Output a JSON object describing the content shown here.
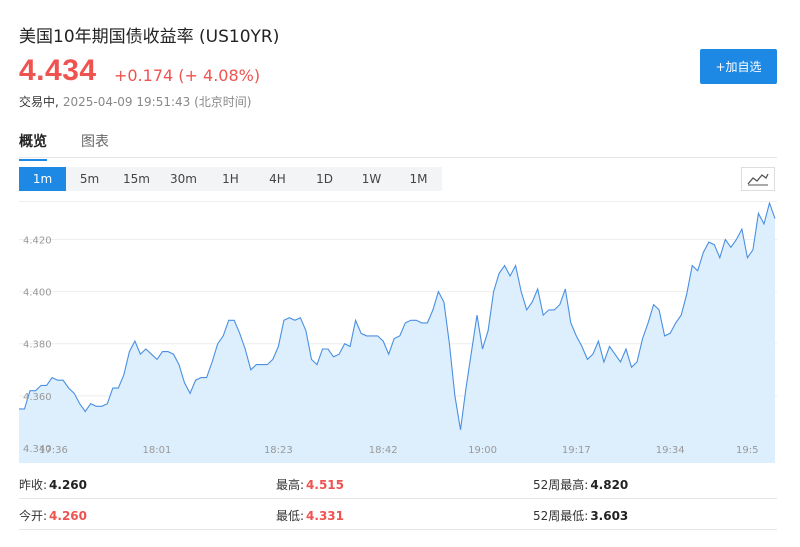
{
  "header": {
    "title": "美国10年期国债收益率 (US10YR)",
    "price": "4.434",
    "change": "+0.174 (+ 4.08%)",
    "status_label": "交易中,",
    "timestamp": "2025-04-09 19:51:43 (北京时间)",
    "add_button": "+加自选"
  },
  "tabs": [
    {
      "label": "概览",
      "active": true
    },
    {
      "label": "图表",
      "active": false
    }
  ],
  "intervals": [
    {
      "label": "1m",
      "active": true
    },
    {
      "label": "5m"
    },
    {
      "label": "15m"
    },
    {
      "label": "30m"
    },
    {
      "label": "1H"
    },
    {
      "label": "4H"
    },
    {
      "label": "1D"
    },
    {
      "label": "1W"
    },
    {
      "label": "1M"
    }
  ],
  "stats": {
    "prev_close": {
      "label": "昨收:",
      "value": "4.260"
    },
    "open": {
      "label": "今开:",
      "value": "4.260"
    },
    "high": {
      "label": "最高:",
      "value": "4.515"
    },
    "low": {
      "label": "最低:",
      "value": "4.331"
    },
    "wk52_high": {
      "label": "52周最高:",
      "value": "4.820"
    },
    "wk52_low": {
      "label": "52周最低:",
      "value": "3.603"
    }
  },
  "colors": {
    "accent": "#1e88e5",
    "up": "#ef5350",
    "line": "#4a90e2",
    "fill": "#ddeefc"
  },
  "chart_data": {
    "type": "area",
    "ylim": [
      4.34,
      4.434
    ],
    "yticks": [
      4.34,
      4.36,
      4.38,
      4.4,
      4.42
    ],
    "ytick_labels": [
      "4.340",
      "4.360",
      "4.380",
      "4.400",
      "4.420"
    ],
    "xticks": [
      {
        "label": "17:36",
        "i": 0
      },
      {
        "label": "18:01",
        "i": 25
      },
      {
        "label": "18:23",
        "i": 47
      },
      {
        "label": "18:42",
        "i": 66
      },
      {
        "label": "19:00",
        "i": 84
      },
      {
        "label": "19:17",
        "i": 101
      },
      {
        "label": "19:34",
        "i": 118
      },
      {
        "label": "19:5",
        "i": 134
      }
    ],
    "values": [
      4.355,
      4.355,
      4.362,
      4.362,
      4.364,
      4.364,
      4.367,
      4.366,
      4.366,
      4.363,
      4.361,
      4.357,
      4.354,
      4.357,
      4.356,
      4.356,
      4.357,
      4.363,
      4.363,
      4.368,
      4.377,
      4.381,
      4.376,
      4.378,
      4.376,
      4.374,
      4.377,
      4.377,
      4.376,
      4.372,
      4.365,
      4.361,
      4.366,
      4.367,
      4.367,
      4.373,
      4.38,
      4.383,
      4.389,
      4.389,
      4.384,
      4.378,
      4.37,
      4.372,
      4.372,
      4.372,
      4.374,
      4.379,
      4.389,
      4.39,
      4.389,
      4.39,
      4.385,
      4.374,
      4.372,
      4.378,
      4.378,
      4.375,
      4.376,
      4.38,
      4.379,
      4.389,
      4.384,
      4.383,
      4.383,
      4.383,
      4.381,
      4.376,
      4.382,
      4.383,
      4.388,
      4.389,
      4.389,
      4.388,
      4.388,
      4.393,
      4.4,
      4.396,
      4.38,
      4.36,
      4.347,
      4.363,
      4.377,
      4.391,
      4.378,
      4.385,
      4.4,
      4.407,
      4.41,
      4.406,
      4.41,
      4.4,
      4.393,
      4.396,
      4.401,
      4.391,
      4.393,
      4.393,
      4.395,
      4.401,
      4.388,
      4.383,
      4.379,
      4.374,
      4.376,
      4.381,
      4.373,
      4.379,
      4.376,
      4.373,
      4.378,
      4.371,
      4.373,
      4.382,
      4.388,
      4.395,
      4.393,
      4.383,
      4.384,
      4.388,
      4.391,
      4.399,
      4.41,
      4.408,
      4.415,
      4.419,
      4.418,
      4.413,
      4.42,
      4.417,
      4.42,
      4.424,
      4.413,
      4.416,
      4.43,
      4.426,
      4.434,
      4.428
    ]
  }
}
